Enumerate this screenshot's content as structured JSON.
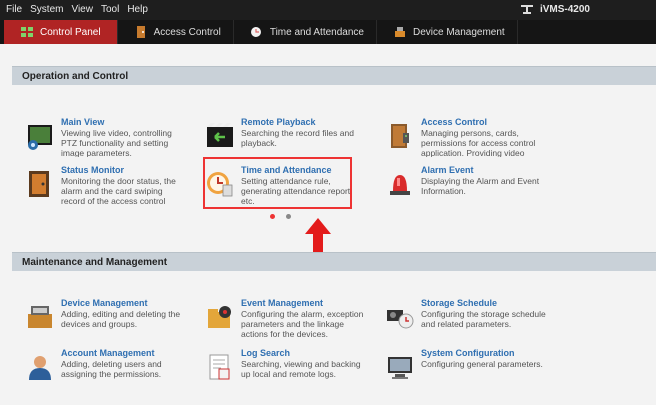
{
  "menubar": {
    "items": [
      "File",
      "System",
      "View",
      "Tool",
      "Help"
    ],
    "app_name": "iVMS-4200"
  },
  "tabs": [
    {
      "label": "Control Panel",
      "active": true,
      "icon": "control-panel-icon"
    },
    {
      "label": "Access Control",
      "active": false,
      "icon": "access-control-icon"
    },
    {
      "label": "Time and Attendance",
      "active": false,
      "icon": "time-attendance-icon"
    },
    {
      "label": "Device Management",
      "active": false,
      "icon": "device-management-icon"
    }
  ],
  "sections": [
    {
      "title": "Operation and Control",
      "items": [
        {
          "title": "Main View",
          "desc": "Viewing live video, controlling PTZ functionality and setting image parameters.",
          "icon": "main-view-icon"
        },
        {
          "title": "Remote Playback",
          "desc": "Searching the record files and playback.",
          "icon": "remote-playback-icon"
        },
        {
          "title": "Access Control",
          "desc": "Managing persons, cards, permissions for access control application. Providing video",
          "icon": "access-control-icon"
        },
        {
          "title": "Status Monitor",
          "desc": "Monitoring the door status, the alarm and the card swiping record of the access control",
          "icon": "status-monitor-icon"
        },
        {
          "title": "Time and Attendance",
          "desc": "Setting attendance rule, generating attendance report, etc.",
          "icon": "time-attendance-icon"
        },
        {
          "title": "Alarm Event",
          "desc": "Displaying the Alarm and Event Information.",
          "icon": "alarm-event-icon"
        }
      ]
    },
    {
      "title": "Maintenance and Management",
      "items": [
        {
          "title": "Device Management",
          "desc": "Adding, editing and deleting the devices and groups.",
          "icon": "device-management-icon"
        },
        {
          "title": "Event Management",
          "desc": "Configuring the alarm, exception parameters and the linkage actions for the devices.",
          "icon": "event-management-icon"
        },
        {
          "title": "Storage Schedule",
          "desc": "Configuring the storage schedule and related parameters.",
          "icon": "storage-schedule-icon"
        },
        {
          "title": "Account Management",
          "desc": "Adding, deleting users and assigning the permissions.",
          "icon": "account-management-icon"
        },
        {
          "title": "Log Search",
          "desc": "Searching, viewing and backing up local and remote logs.",
          "icon": "log-search-icon"
        },
        {
          "title": "System Configuration",
          "desc": "Configuring general parameters.",
          "icon": "system-configuration-icon"
        }
      ]
    }
  ],
  "pagination": {
    "pages": 2,
    "current": 1
  },
  "colors": {
    "accent": "#b02424",
    "link": "#2f6fb1",
    "highlight": "#e33333"
  }
}
